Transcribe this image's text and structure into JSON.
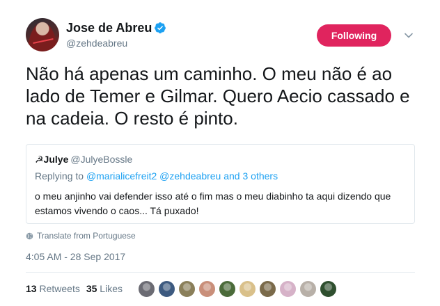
{
  "author": {
    "name": "Jose de Abreu",
    "handle": "@zehdeabreu",
    "verified": true
  },
  "follow_label": "Following",
  "tweet_text": "Não há apenas um caminho. O meu não é ao lado de Temer e Gilmar. Quero Aecio cassado e na cadeia. O resto é pinto.",
  "quoted": {
    "name": "☭Julye",
    "handle": "@JulyeBossle",
    "replying_prefix": "Replying to",
    "replying_to": "@marialicefreit2 @zehdeabreu and 3 others",
    "text": "o meu anjinho vai defender isso até o fim mas o meu diabinho ta aqui dizendo que estamos vivendo o caos... Tá puxado!"
  },
  "translate_label": "Translate from Portuguese",
  "timestamp": "4:05 AM - 28 Sep 2017",
  "stats": {
    "retweets_count": "13",
    "retweets_label": "Retweets",
    "likes_count": "35",
    "likes_label": "Likes"
  },
  "colors": {
    "follow_button": "#e0245e",
    "verified": "#1da1f2",
    "link": "#1da1f2",
    "secondary_text": "#657786"
  },
  "liker_avatars": [
    "#6b6b73",
    "#3d5a80",
    "#8a7f5a",
    "#c98f7a",
    "#4b6b3a",
    "#d9c08a",
    "#7a6a4a",
    "#d6b2c8",
    "#b8b0a8",
    "#2f4f2f"
  ]
}
